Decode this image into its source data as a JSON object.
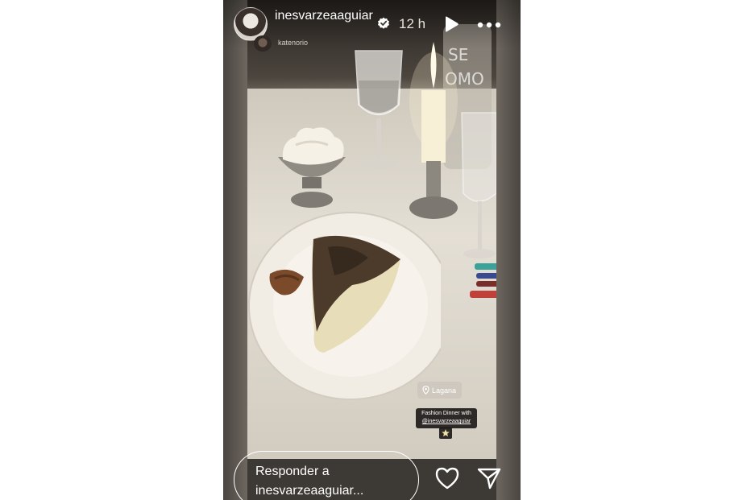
{
  "header": {
    "username": "inesvarzeaaguiar",
    "time_ago": "12 h",
    "verified_icon": "verified-badge-icon",
    "play_icon": "play-icon",
    "more_icon": "more-options-icon"
  },
  "collaborator": {
    "username": "katenorio"
  },
  "stickers": {
    "location": "Lagana",
    "location_icon": "location-pin-icon",
    "caption_line1": "Fashion Dinner with",
    "caption_mention": "@inesvarzeaaguiar",
    "caption_emoji": "star-icon"
  },
  "reply": {
    "line1": "Responder a",
    "line2": "inesvarzeaaguiar..."
  },
  "actions": {
    "like_icon": "heart-icon",
    "send_icon": "send-icon"
  },
  "colors": {
    "story_bg": "#3d3934",
    "text": "#ffffff"
  }
}
